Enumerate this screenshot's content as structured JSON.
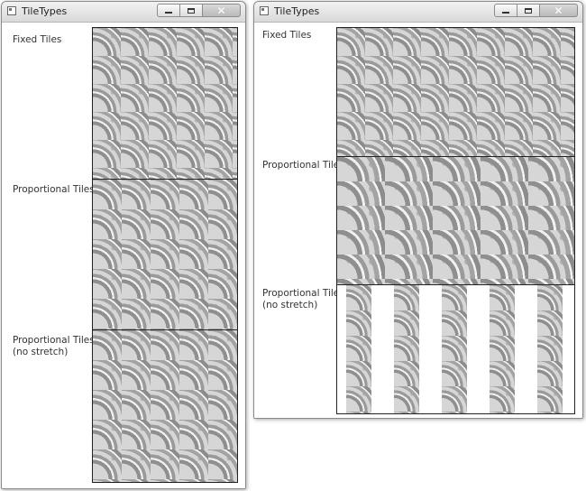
{
  "windows": [
    {
      "title": "TileTypes",
      "rows": [
        {
          "label": "Fixed Tiles"
        },
        {
          "label": "Proportional Tiles"
        },
        {
          "label": "Proportional Tiles\n(no stretch)"
        }
      ]
    },
    {
      "title": "TileTypes",
      "rows": [
        {
          "label": "Fixed Tiles"
        },
        {
          "label": "Proportional Tiles"
        },
        {
          "label": "Proportional Tiles\n(no stretch)"
        }
      ]
    }
  ],
  "caption_buttons": {
    "minimize": "minimize-icon",
    "maximize": "maximize-icon",
    "close": "✕"
  }
}
